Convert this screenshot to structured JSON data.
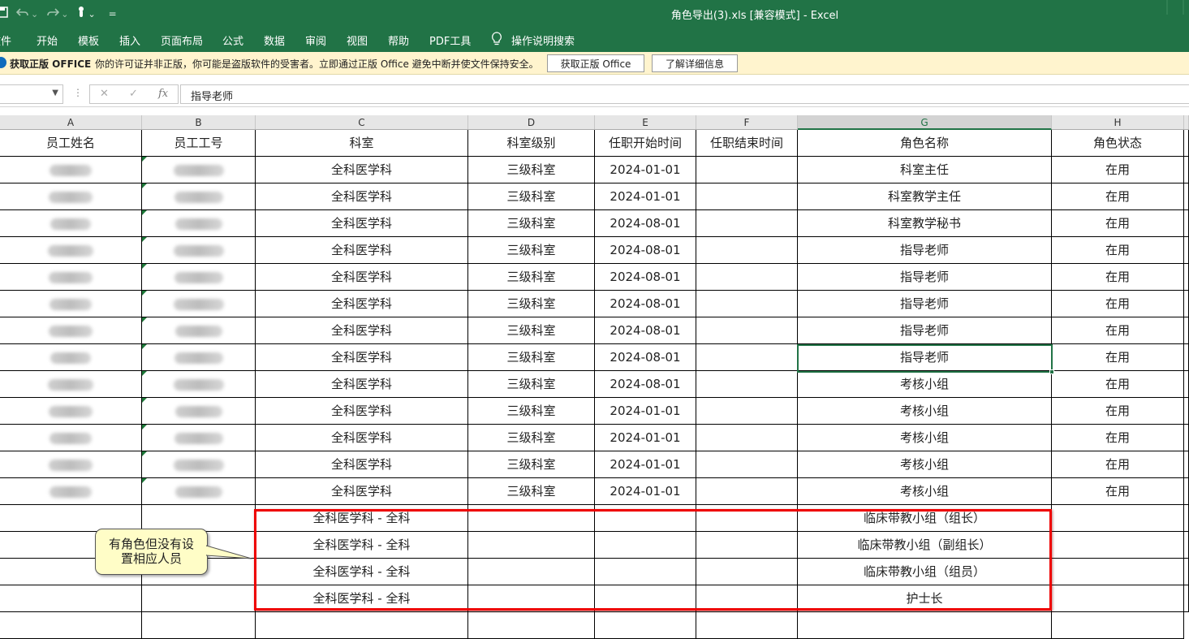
{
  "window": {
    "title": "角色导出(3).xls  [兼容模式]  -  Excel"
  },
  "quick_access": {
    "dropdown_glyph": "⌄",
    "customize_glyph": "="
  },
  "ribbon": {
    "tabs": [
      "文件",
      "开始",
      "模板",
      "插入",
      "页面布局",
      "公式",
      "数据",
      "审阅",
      "视图",
      "帮助",
      "PDF工具"
    ],
    "search_label": "操作说明搜索"
  },
  "message_bar": {
    "title": "获取正版 OFFICE",
    "message": "你的许可证并非正版，你可能是盗版软件的受害者。立即通过正版 Office 避免中断并使文件保持安全。",
    "button_primary": "获取正版 Office",
    "button_secondary": "了解详细信息"
  },
  "formula_bar": {
    "cancel_glyph": "✕",
    "enter_glyph": "✓",
    "fx_label": "fx",
    "separator": "⋮",
    "value": "指导老师"
  },
  "columns": [
    "A",
    "B",
    "C",
    "D",
    "E",
    "F",
    "G",
    "H"
  ],
  "header_row": [
    "员工姓名",
    "员工工号",
    "科室",
    "科室级别",
    "任职开始时间",
    "任职结束时间",
    "角色名称",
    "角色状态"
  ],
  "rows": [
    {
      "dept": "全科医学科",
      "level": "三级科室",
      "start": "2024-01-01",
      "end": "",
      "role": "科室主任",
      "status": "在用"
    },
    {
      "dept": "全科医学科",
      "level": "三级科室",
      "start": "2024-01-01",
      "end": "",
      "role": "科室教学主任",
      "status": "在用"
    },
    {
      "dept": "全科医学科",
      "level": "三级科室",
      "start": "2024-08-01",
      "end": "",
      "role": "科室教学秘书",
      "status": "在用"
    },
    {
      "dept": "全科医学科",
      "level": "三级科室",
      "start": "2024-08-01",
      "end": "",
      "role": "指导老师",
      "status": "在用"
    },
    {
      "dept": "全科医学科",
      "level": "三级科室",
      "start": "2024-08-01",
      "end": "",
      "role": "指导老师",
      "status": "在用"
    },
    {
      "dept": "全科医学科",
      "level": "三级科室",
      "start": "2024-08-01",
      "end": "",
      "role": "指导老师",
      "status": "在用"
    },
    {
      "dept": "全科医学科",
      "level": "三级科室",
      "start": "2024-08-01",
      "end": "",
      "role": "指导老师",
      "status": "在用"
    },
    {
      "dept": "全科医学科",
      "level": "三级科室",
      "start": "2024-08-01",
      "end": "",
      "role": "指导老师",
      "status": "在用"
    },
    {
      "dept": "全科医学科",
      "level": "三级科室",
      "start": "2024-08-01",
      "end": "",
      "role": "考核小组",
      "status": "在用"
    },
    {
      "dept": "全科医学科",
      "level": "三级科室",
      "start": "2024-01-01",
      "end": "",
      "role": "考核小组",
      "status": "在用"
    },
    {
      "dept": "全科医学科",
      "level": "三级科室",
      "start": "2024-01-01",
      "end": "",
      "role": "考核小组",
      "status": "在用"
    },
    {
      "dept": "全科医学科",
      "level": "三级科室",
      "start": "2024-01-01",
      "end": "",
      "role": "考核小组",
      "status": "在用"
    },
    {
      "dept": "全科医学科",
      "level": "三级科室",
      "start": "2024-01-01",
      "end": "",
      "role": "考核小组",
      "status": "在用"
    },
    {
      "dept": "全科医学科 - 全科",
      "level": "",
      "start": "",
      "end": "",
      "role": "临床带教小组（组长）",
      "status": ""
    },
    {
      "dept": "全科医学科 - 全科",
      "level": "",
      "start": "",
      "end": "",
      "role": "临床带教小组（副组长）",
      "status": ""
    },
    {
      "dept": "全科医学科 - 全科",
      "level": "",
      "start": "",
      "end": "",
      "role": "临床带教小组（组员）",
      "status": ""
    },
    {
      "dept": "全科医学科 - 全科",
      "level": "",
      "start": "",
      "end": "",
      "role": "护士长",
      "status": ""
    }
  ],
  "annotation": {
    "callout_line1": "有角色但没有设",
    "callout_line2": "置相应人员"
  },
  "colors": {
    "excel_green": "#217346",
    "highlight_red": "#e00000",
    "callout_fill": "#fffdc7"
  }
}
